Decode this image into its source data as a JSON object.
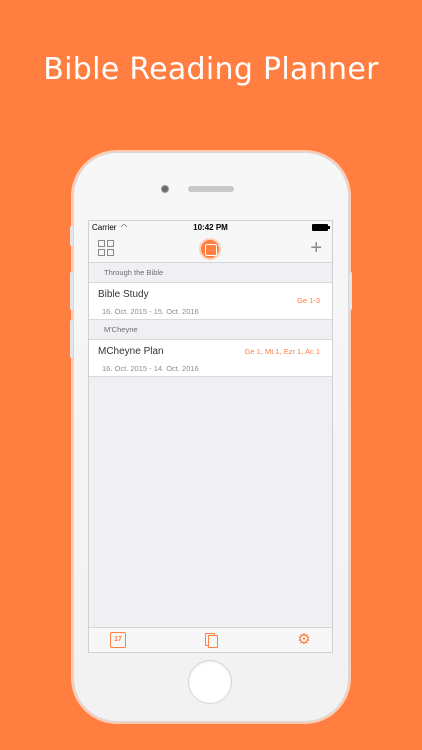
{
  "headline": "Bible Reading Planner",
  "status_bar": {
    "carrier": "Carrier",
    "time": "10:42 PM"
  },
  "nav_bar": {
    "left_icon": "grid-icon",
    "center_icon": "bible-logo-icon",
    "right_icon": "add-icon",
    "add_glyph": "+"
  },
  "sections": [
    {
      "header": "Through the Bible",
      "plans": [
        {
          "name": "Bible Study",
          "dates": "16. Oct. 2015 - 15. Oct. 2016",
          "reading": "Ge 1-3"
        }
      ]
    },
    {
      "header": "M'Cheyne",
      "plans": [
        {
          "name": "MCheyne Plan",
          "dates": "16. Oct. 2015 - 14. Oct. 2016",
          "reading": "Ge 1, Mt 1, Ezr 1, Ac 1"
        }
      ]
    }
  ],
  "tab_bar": {
    "calendar_day": "17",
    "items": [
      "calendar-icon",
      "book-icon",
      "gear-icon"
    ]
  },
  "colors": {
    "accent": "#ff7e40",
    "background": "#ff7e40",
    "screen_bg": "#efeff4"
  }
}
